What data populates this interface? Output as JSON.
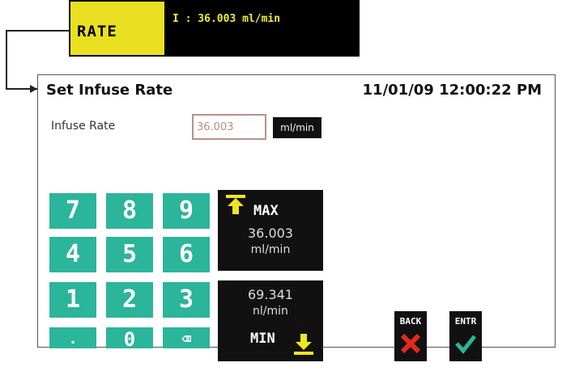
{
  "top_bar": {
    "label": "RATE",
    "value": "I : 36.003 ml/min"
  },
  "screen": {
    "title": "Set Infuse Rate",
    "datetime": "11/01/09 12:00:22 PM",
    "field_label": "Infuse Rate",
    "field_value": "36.003",
    "unit": "ml/min"
  },
  "keypad": {
    "keys": [
      "7",
      "8",
      "9",
      "4",
      "5",
      "6",
      "1",
      "2",
      "3",
      ".",
      "0",
      "⌫"
    ]
  },
  "max_panel": {
    "label": "MAX",
    "value": "36.003",
    "unit": "ml/min"
  },
  "min_panel": {
    "label": "MIN",
    "value": "69.341",
    "unit": "nl/min"
  },
  "softkeys": {
    "back": "BACK",
    "enter": "ENTR"
  },
  "colors": {
    "rate_yellow": "#e8e020",
    "keypad_teal": "#2bb59a",
    "arrow_yellow": "#f2e51f",
    "back_red": "#e02a20",
    "enter_teal": "#2bb59a"
  }
}
